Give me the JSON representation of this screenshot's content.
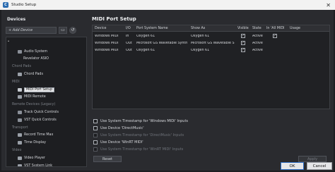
{
  "window": {
    "title": "Studio Setup",
    "close_glyph": "✕"
  },
  "left": {
    "header": "Devices",
    "add_device": "+ Add Device",
    "toolbar_icons": [
      "remove-device-icon",
      "reset-icon"
    ],
    "tree": [
      {
        "kind": "dev",
        "label": "Audio System",
        "icon": "audio-system-icon"
      },
      {
        "kind": "sub",
        "label": "Revelator ASIO"
      },
      {
        "kind": "cat",
        "label": "Chord Pads"
      },
      {
        "kind": "dev",
        "label": "Chord Pads",
        "icon": "chord-pads-icon"
      },
      {
        "kind": "cat",
        "label": "MIDI"
      },
      {
        "kind": "dev",
        "label": "MIDI Port Setup",
        "icon": "midi-port-icon",
        "selected": true
      },
      {
        "kind": "dev",
        "label": "MIDI Remote",
        "icon": "midi-remote-icon"
      },
      {
        "kind": "cat",
        "label": "Remote Devices (Legacy)"
      },
      {
        "kind": "dev",
        "label": "Track Quick Controls",
        "icon": "quick-controls-icon"
      },
      {
        "kind": "dev",
        "label": "VST Quick Controls",
        "icon": "quick-controls-icon"
      },
      {
        "kind": "cat",
        "label": "Transport"
      },
      {
        "kind": "dev",
        "label": "Record Time Max",
        "icon": "clock-icon"
      },
      {
        "kind": "dev",
        "label": "Time Display",
        "icon": "clock-icon"
      },
      {
        "kind": "cat",
        "label": "Video"
      },
      {
        "kind": "dev",
        "label": "Video Player",
        "icon": "video-icon"
      },
      {
        "kind": "dev",
        "label": "VST System Link",
        "icon": "system-link-icon"
      }
    ]
  },
  "right": {
    "header": "MIDI Port Setup",
    "columns": [
      "Device",
      "I/O",
      "Port System Name",
      "Show As",
      "Visible",
      "State",
      "In 'All MIDI",
      "Usage"
    ],
    "rows": [
      {
        "device": "Windows MIDI",
        "io": "In",
        "port": "Oxygen 61",
        "show_as": "Oxygen 61",
        "visible": true,
        "state": "Active",
        "in_all_midi": true,
        "usage": ""
      },
      {
        "device": "Windows MIDI",
        "io": "Out",
        "port": "Microsoft GS Wavetable Synth",
        "show_as": "Microsoft GS Wavetable S",
        "visible": true,
        "state": "Active",
        "in_all_midi": false,
        "usage": ""
      },
      {
        "device": "Windows MIDI",
        "io": "Out",
        "port": "Oxygen 61",
        "show_as": "Oxygen 61",
        "visible": true,
        "state": "Active",
        "in_all_midi": false,
        "usage": ""
      }
    ],
    "options": [
      {
        "label": "Use System Timestamp for 'Windows MIDI' Inputs",
        "enabled": true
      },
      {
        "label": "Use Device 'DirectMusic'",
        "enabled": true
      },
      {
        "label": "Use System Timestamp for 'DirectMusic' Inputs",
        "enabled": false
      },
      {
        "label": "Use Device 'WinRT MIDI'",
        "enabled": true
      },
      {
        "label": "Use System Timestamp for 'WinRT MIDI' Inputs",
        "enabled": false
      }
    ],
    "reset_label": "Reset",
    "apply_label": "Apply"
  },
  "footer": {
    "ok_label": "OK",
    "cancel_label": "Cancel"
  },
  "colors": {
    "accent": "#2f6fc7",
    "panel": "#2a2b2f",
    "list_bg": "#202124"
  }
}
